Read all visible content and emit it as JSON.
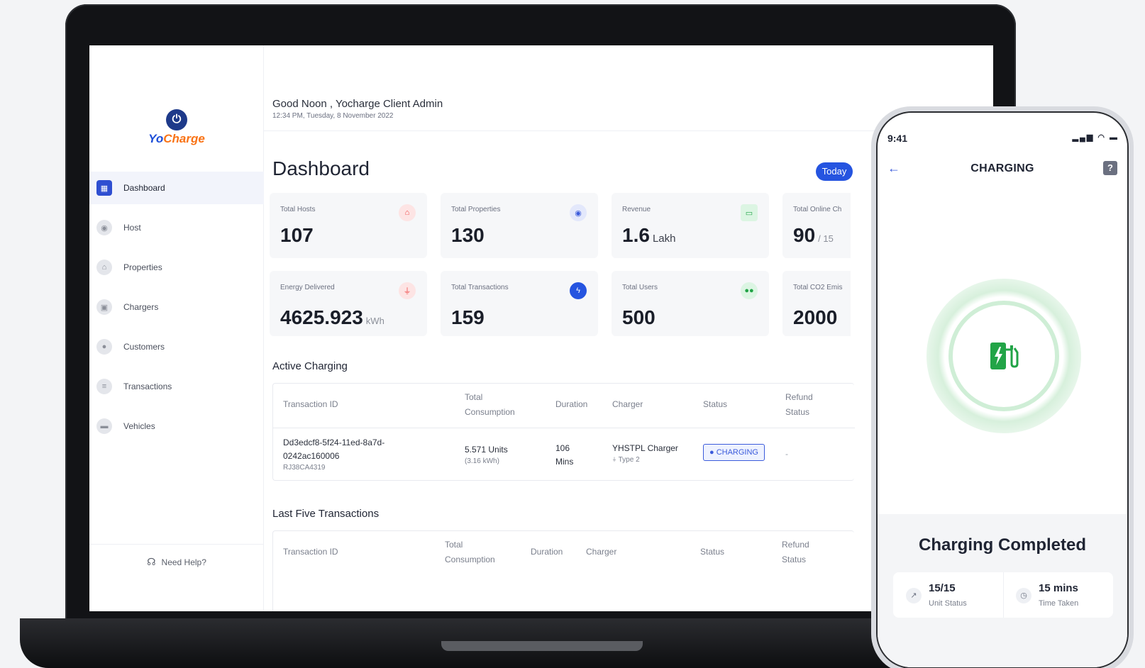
{
  "brand": {
    "logo_yo": "Yo",
    "logo_charge": "Charge"
  },
  "sidebar": {
    "items": [
      {
        "label": "Dashboard"
      },
      {
        "label": "Host"
      },
      {
        "label": "Properties"
      },
      {
        "label": "Chargers"
      },
      {
        "label": "Customers"
      },
      {
        "label": "Transactions"
      },
      {
        "label": "Vehicles"
      }
    ],
    "help_label": "Need Help?"
  },
  "header": {
    "greeting": "Good Noon , Yocharge Client Admin",
    "datetime": "12:34 PM, Tuesday, 8 November 2022"
  },
  "main": {
    "title": "Dashboard",
    "today_label": "Today"
  },
  "cards": [
    {
      "label": "Total Hosts",
      "value": "107",
      "unit": "",
      "icon": "house-icon",
      "color": "#ef4444"
    },
    {
      "label": "Total Properties",
      "value": "130",
      "unit": "",
      "icon": "location-pin-icon",
      "color": "#3b5bdb"
    },
    {
      "label": "Revenue",
      "value": "1.6",
      "unit": "Lakh",
      "icon": "cash-icon",
      "color": "#22c55e"
    },
    {
      "label": "Total Online Ch",
      "value": "90",
      "unit": "/ 15",
      "icon": "",
      "color": ""
    },
    {
      "label": "Energy Delivered",
      "value": "4625.923",
      "unit": "kWh",
      "icon": "plug-icon",
      "color": "#ef4444"
    },
    {
      "label": "Total Transactions",
      "value": "159",
      "unit": "",
      "icon": "bolt-icon",
      "color": "#2554e0"
    },
    {
      "label": "Total Users",
      "value": "500",
      "unit": "",
      "icon": "users-icon",
      "color": "#22c55e"
    },
    {
      "label": "Total CO2 Emis",
      "value": "2000",
      "unit": "",
      "icon": "",
      "color": ""
    }
  ],
  "active_charging": {
    "title": "Active Charging",
    "headers": [
      "Transaction ID",
      "Total Consumption",
      "Duration",
      "Charger",
      "Status",
      "Refund Status"
    ],
    "row": {
      "transaction_id": "Dd3edcf8-5f24-11ed-8a7d-0242ac160006",
      "transaction_sub": "RJ38CA4319",
      "consumption": "5.571 Units",
      "consumption_sub": "(3.16 kWh)",
      "duration": "106 Mins",
      "charger": "YHSTPL Charger",
      "charger_sub": "Type 2",
      "status": "CHARGING",
      "refund": "-"
    }
  },
  "last_five": {
    "title": "Last Five Transactions",
    "headers": [
      "Transaction ID",
      "Total Consumption",
      "Duration",
      "Charger",
      "Status",
      "Refund Status"
    ]
  },
  "phone": {
    "time": "9:41",
    "title": "CHARGING",
    "help_label": "?",
    "completed": "Charging Completed",
    "unit_status_value": "15/15",
    "unit_status_label": "Unit Status",
    "time_taken_value": "15 mins",
    "time_taken_label": "Time Taken",
    "accent": "#22a447"
  }
}
